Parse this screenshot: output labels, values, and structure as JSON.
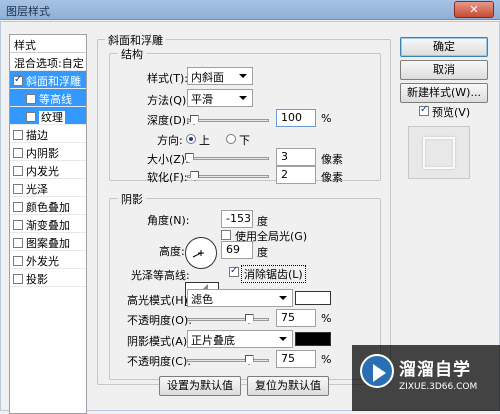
{
  "window": {
    "title": "图层样式",
    "close_glyph": "✕"
  },
  "styles_panel": {
    "header": "样式",
    "blend_options": "混合选项:自定",
    "items": [
      {
        "label": "斜面和浮雕",
        "checked": true
      },
      {
        "label": "等高线",
        "checked": false
      },
      {
        "label": "纹理",
        "checked": false
      },
      {
        "label": "描边",
        "checked": false
      },
      {
        "label": "内阴影",
        "checked": false
      },
      {
        "label": "内发光",
        "checked": false
      },
      {
        "label": "光泽",
        "checked": false
      },
      {
        "label": "颜色叠加",
        "checked": false
      },
      {
        "label": "渐变叠加",
        "checked": false
      },
      {
        "label": "图案叠加",
        "checked": false
      },
      {
        "label": "外发光",
        "checked": false
      },
      {
        "label": "投影",
        "checked": false
      }
    ]
  },
  "bevel": {
    "group_title": "斜面和浮雕",
    "structure_title": "结构",
    "style_label": "样式(T):",
    "style_value": "内斜面",
    "technique_label": "方法(Q):",
    "technique_value": "平滑",
    "depth_label": "深度(D):",
    "depth_value": "100",
    "depth_unit": "%",
    "depth_level": 0.08,
    "direction_label": "方向:",
    "direction_up": "上",
    "direction_down": "下",
    "size_label": "大小(Z):",
    "size_value": "3",
    "size_unit": "像素",
    "size_level": 0.02,
    "soften_label": "软化(F):",
    "soften_value": "2",
    "soften_unit": "像素",
    "soften_level": 0.09
  },
  "shading": {
    "title": "阴影",
    "angle_label": "角度(N):",
    "angle_value": "-153",
    "angle_unit": "度",
    "global_light_label": "使用全局光(G)",
    "altitude_label": "高度:",
    "altitude_value": "69",
    "altitude_unit": "度",
    "gloss_contour_label": "光泽等高线:",
    "anti_alias_label": "消除锯齿(L)",
    "highlight_mode_label": "高光模式(H):",
    "highlight_mode_value": "滤色",
    "highlight_color": "#ffffff",
    "highlight_opacity_label": "不透明度(O):",
    "highlight_opacity_value": "75",
    "highlight_opacity_unit": "%",
    "highlight_opacity_level": 0.75,
    "shadow_mode_label": "阴影模式(A):",
    "shadow_mode_value": "正片叠底",
    "shadow_color": "#000000",
    "shadow_opacity_label": "不透明度(C):",
    "shadow_opacity_value": "75",
    "shadow_opacity_unit": "%",
    "shadow_opacity_level": 0.75
  },
  "buttons": {
    "make_default": "设置为默认值",
    "reset_default": "复位为默认值",
    "ok": "确定",
    "cancel": "取消",
    "new_style": "新建样式(W)...",
    "preview_label": "预览(V)"
  },
  "watermark": {
    "title": "溜溜自学",
    "subtitle": "ZIXUE.3D66.COM"
  }
}
